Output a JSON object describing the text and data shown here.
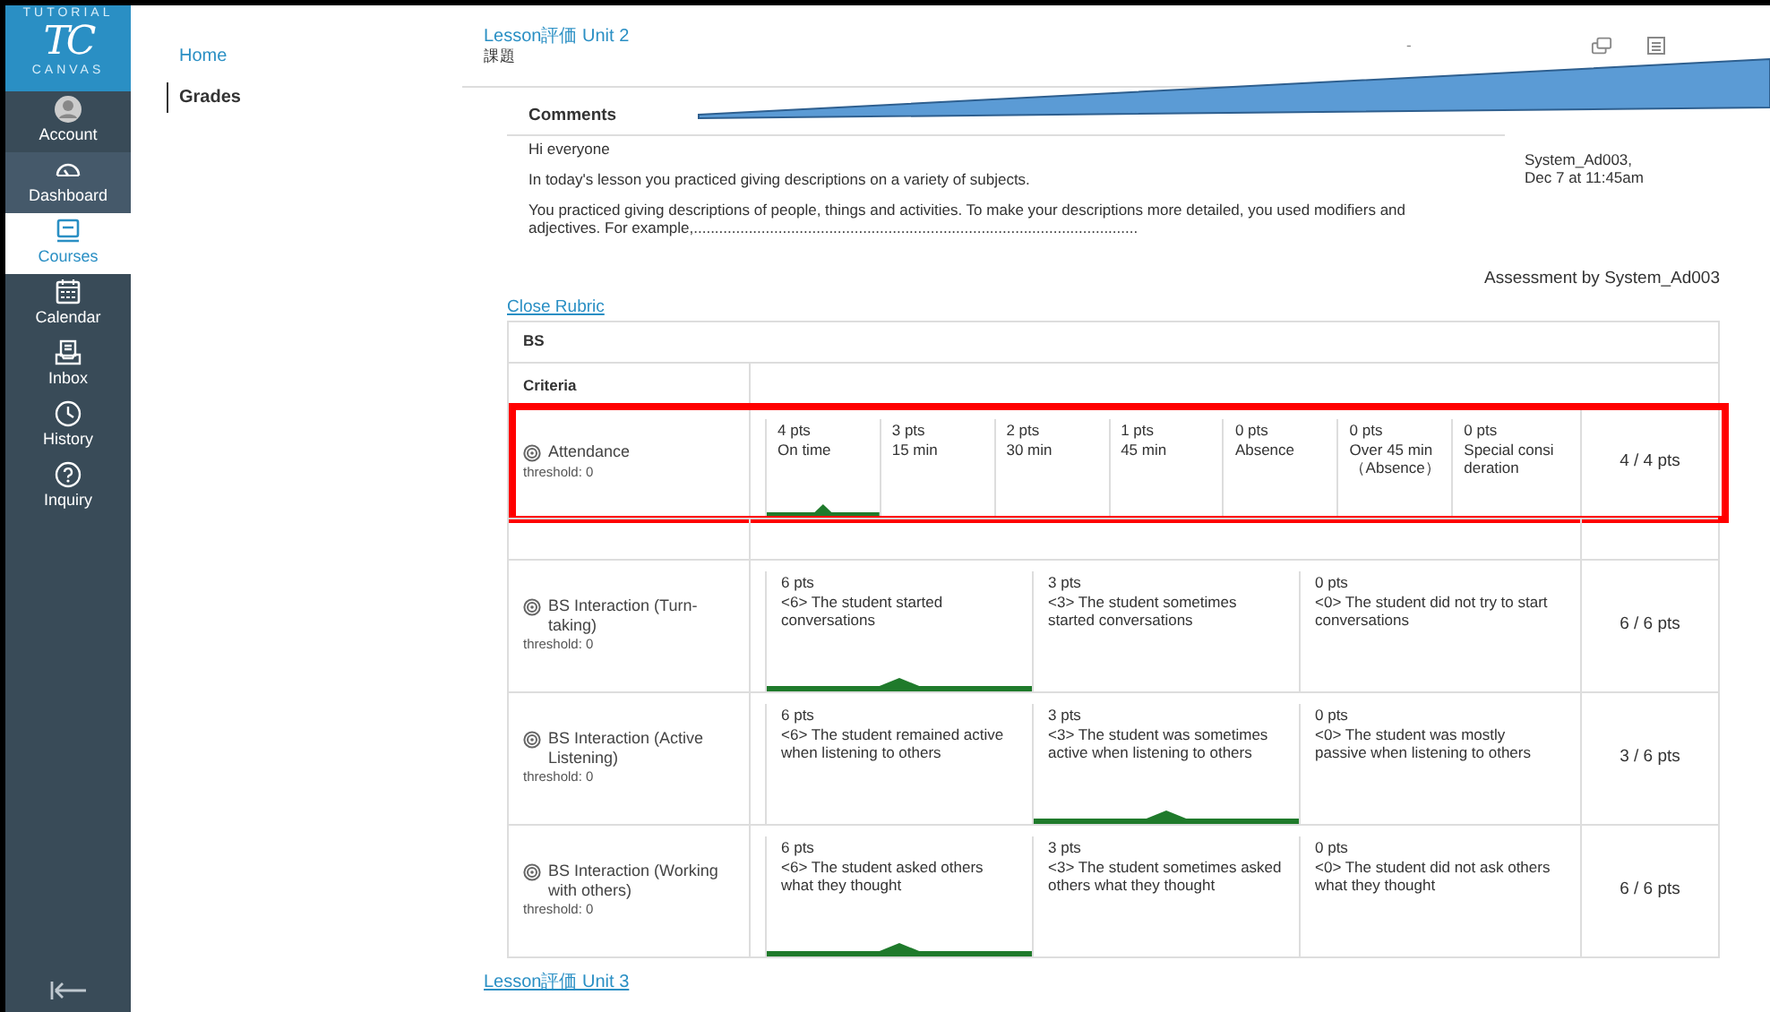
{
  "sidebar": {
    "logo": {
      "top": "TUTORIAL",
      "mark": "TC",
      "bottom": "CANVAS"
    },
    "items": [
      {
        "label": "Account",
        "selected": false
      },
      {
        "label": "Dashboard",
        "selected": false
      },
      {
        "label": "Courses",
        "selected": true
      },
      {
        "label": "Calendar",
        "selected": false
      },
      {
        "label": "Inbox",
        "selected": false
      },
      {
        "label": "History",
        "selected": false
      },
      {
        "label": "Inquiry",
        "selected": false
      }
    ]
  },
  "course_nav": [
    {
      "label": "Home",
      "selected": false
    },
    {
      "label": "Grades",
      "selected": true
    }
  ],
  "header": {
    "title": "Lesson評価 Unit 2",
    "subtitle": "課題",
    "marker": "-"
  },
  "comments": {
    "heading": "Comments",
    "paragraphs": [
      "Hi everyone",
      "In today's lesson you practiced giving descriptions on a variety of subjects.",
      "You practiced giving descriptions of people, things and activities. To make your descriptions more detailed, you used modifiers and adjectives. For example,........................................................................................................."
    ],
    "author": "System_Ad003,",
    "date": "Dec 7 at 11:45am"
  },
  "assessment_by": "Assessment by System_Ad003",
  "close_rubric": "Close Rubric",
  "rubric": {
    "title": "BS",
    "criteria_heading": "Criteria",
    "rows": [
      {
        "name": "Attendance",
        "threshold": "threshold: 0",
        "score": "4 / 4 pts",
        "highlighted": true,
        "ratings": [
          {
            "points": "4 pts",
            "description": "On time",
            "selected": true
          },
          {
            "points": "3 pts",
            "description": "15 min",
            "selected": false
          },
          {
            "points": "2 pts",
            "description": "30 min",
            "selected": false
          },
          {
            "points": "1 pts",
            "description": "45 min",
            "selected": false
          },
          {
            "points": "0 pts",
            "description": "Absence",
            "selected": false
          },
          {
            "points": "0 pts",
            "description": "Over 45 min （Absence）",
            "selected": false
          },
          {
            "points": "0 pts",
            "description": "Special consideration",
            "selected": false
          }
        ]
      },
      {
        "name": "BS Interaction (Turn-taking)",
        "threshold": "threshold: 0",
        "score": "6 / 6 pts",
        "highlighted": false,
        "ratings": [
          {
            "points": "6 pts",
            "description": "<6> The student started conversations",
            "selected": true
          },
          {
            "points": "3 pts",
            "description": "<3> The student sometimes started conversations",
            "selected": false
          },
          {
            "points": "0 pts",
            "description": "<0> The student did not try to start conversations",
            "selected": false
          }
        ]
      },
      {
        "name": "BS Interaction (Active Listening)",
        "threshold": "threshold: 0",
        "score": "3 / 6 pts",
        "highlighted": false,
        "ratings": [
          {
            "points": "6 pts",
            "description": "<6> The student remained active when listening to others",
            "selected": false
          },
          {
            "points": "3 pts",
            "description": "<3> The student was sometimes active when listening to others",
            "selected": true
          },
          {
            "points": "0 pts",
            "description": "<0> The student was mostly passive when listening to others",
            "selected": false
          }
        ]
      },
      {
        "name": "BS Interaction (Working with others)",
        "threshold": "threshold: 0",
        "score": "6 / 6 pts",
        "highlighted": false,
        "ratings": [
          {
            "points": "6 pts",
            "description": "<6> The student asked others what they thought",
            "selected": true
          },
          {
            "points": "3 pts",
            "description": "<3> The student sometimes asked others what they thought",
            "selected": false
          },
          {
            "points": "0 pts",
            "description": "<0> The student did not ask others what they thought",
            "selected": false
          }
        ]
      }
    ]
  },
  "next_assignment": "Lesson評価 Unit 3",
  "annotations": {
    "callout_arrow": true
  }
}
